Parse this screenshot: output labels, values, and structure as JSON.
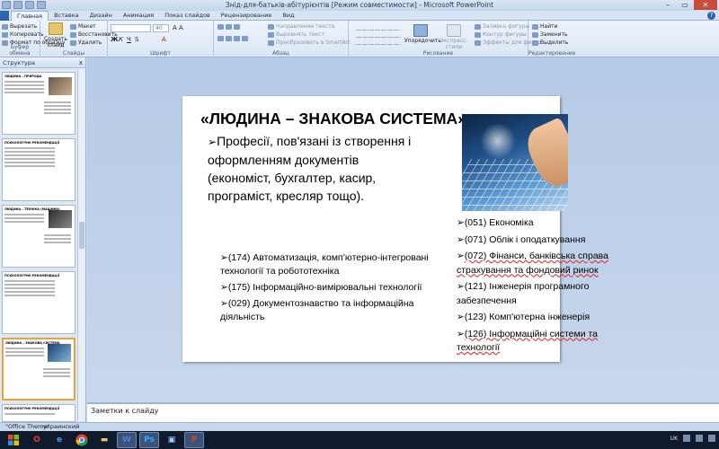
{
  "window": {
    "title": "Знід-для-батьків-абітурієнтів [Режим совместимости] - Microsoft PowerPoint",
    "buttons": [
      "–",
      "▭",
      "✕"
    ]
  },
  "ribbon_tabs": [
    "Главная",
    "Вставка",
    "Дизайн",
    "Анимация",
    "Показ слайдов",
    "Рецензирование",
    "Вид"
  ],
  "ribbon": {
    "clipboard": {
      "label": "Буфер обмена",
      "items": [
        "Вырезать",
        "Копировать",
        "Формат по образцу"
      ]
    },
    "slides": {
      "label": "Слайды",
      "new_slide": "Создать слайд",
      "items": [
        "Макет",
        "Восстановить",
        "Удалить"
      ]
    },
    "font": {
      "label": "Шрифт",
      "size_value": "40"
    },
    "paragraph": {
      "label": "Абзац",
      "items": [
        "Направление текста",
        "Выровнять текст",
        "Преобразовать в SmartArt"
      ]
    },
    "drawing": {
      "label": "Рисование",
      "arrange": "Упорядочить",
      "quick_styles": "Экспресс-стили",
      "items": [
        "Заливка фигуры",
        "Контур фигуры",
        "Эффекты для фигур"
      ]
    },
    "editing": {
      "label": "Редактирование",
      "items": [
        "Найти",
        "Заменить",
        "Выделить"
      ]
    }
  },
  "left_panel": {
    "tab_label": "Структура",
    "close": "x"
  },
  "thumbnails": [
    {
      "title": "ЛЮДИНА – ПРИРОДА"
    },
    {
      "title": "ПСИХОЛОГІЧНІ РЕКОМЕНДАЦІЇ"
    },
    {
      "title": "ЛЮДИНА – ТЕХНІКА (МАШИНА)"
    },
    {
      "title": "ПСИХОЛОГІЧНІ РЕКОМЕНДАЦІЇ"
    },
    {
      "title": "ЛЮДИНА – ЗНАКОВА СИСТЕМА"
    },
    {
      "title": "ПСИХОЛОГІЧНІ РЕКОМЕНДАЦІЇ"
    }
  ],
  "slide": {
    "title": "«ЛЮДИНА – ЗНАКОВА СИСТЕМА»",
    "body": "Професії, пов'язані із створення і оформленням документів (економіст, бухгалтер, касир, програміст, кресляр тощо).",
    "right_list": [
      "(051) Економіка",
      "(071) Облік і оподаткування",
      "(072) Фінанси, банківська справа страхування та фондовий ринок",
      "(121) Інженерія програмного забезпечення",
      "(123) Комп'ютерна інженерія",
      "(126) Інформаційні системи та технології"
    ],
    "left_list": [
      "(174) Автоматизація, комп’ютерно-інтегровані технології та робототехніка",
      "(175) Інформаційно-вимірювальні технології",
      "(029) Документознавство та інформаційна діяльність"
    ]
  },
  "notes": {
    "placeholder": "Заметки к слайду"
  },
  "status": {
    "theme": "\"Office Theme\"",
    "language": "украинский"
  },
  "taskbar": {
    "apps": [
      "opera",
      "explorer",
      "chrome",
      "files",
      "word",
      "photoshop",
      "slides",
      "powerpoint"
    ],
    "tray": {
      "lang": "UK"
    }
  }
}
